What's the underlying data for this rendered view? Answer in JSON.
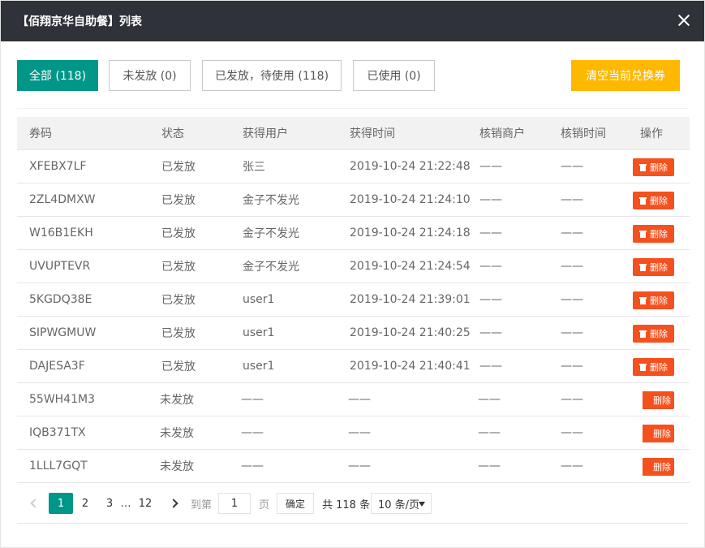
{
  "dialog": {
    "title": "【佰翔京华自助餐】列表"
  },
  "tabs": [
    {
      "label": "全部 (118)",
      "active": true
    },
    {
      "label": "未发放 (0)",
      "active": false
    },
    {
      "label": "已发放，待使用 (118)",
      "active": false
    },
    {
      "label": "已使用 (0)",
      "active": false
    }
  ],
  "clear_button": "清空当前兑换券",
  "table": {
    "headers": {
      "code": "券码",
      "status": "状态",
      "user": "获得用户",
      "time": "获得时间",
      "shop": "核销商户",
      "used_time": "核销时间",
      "op": "操作"
    },
    "delete_label": "删除",
    "rows": [
      {
        "code": "XFEBX7LF",
        "status": "已发放",
        "user": "张三",
        "time": "2019-10-24 21:22:48",
        "shop": "——",
        "used_time": "——"
      },
      {
        "code": "2ZL4DMXW",
        "status": "已发放",
        "user": "金子不发光",
        "time": "2019-10-24 21:24:10",
        "shop": "——",
        "used_time": "——"
      },
      {
        "code": "W16B1EKH",
        "status": "已发放",
        "user": "金子不发光",
        "time": "2019-10-24 21:24:18",
        "shop": "——",
        "used_time": "——"
      },
      {
        "code": "UVUPTEVR",
        "status": "已发放",
        "user": "金子不发光",
        "time": "2019-10-24 21:24:54",
        "shop": "——",
        "used_time": "——"
      },
      {
        "code": "5KGDQ38E",
        "status": "已发放",
        "user": "user1",
        "time": "2019-10-24 21:39:01",
        "shop": "——",
        "used_time": "——"
      },
      {
        "code": "SIPWGMUW",
        "status": "已发放",
        "user": "user1",
        "time": "2019-10-24 21:40:25",
        "shop": "——",
        "used_time": "——"
      },
      {
        "code": "DAJESA3F",
        "status": "已发放",
        "user": "user1",
        "time": "2019-10-24 21:40:41",
        "shop": "——",
        "used_time": "——"
      },
      {
        "code": "55WH41M3",
        "status": "未发放",
        "user": "——",
        "time": "——",
        "shop": "——",
        "used_time": "——"
      },
      {
        "code": "IQB371TX",
        "status": "未发放",
        "user": "——",
        "time": "——",
        "shop": "——",
        "used_time": "——"
      },
      {
        "code": "1LLL7GQT",
        "status": "未发放",
        "user": "——",
        "time": "——",
        "shop": "——",
        "used_time": "——"
      }
    ]
  },
  "pagination": {
    "pages": [
      "1",
      "2",
      "3",
      "…",
      "12"
    ],
    "current": "1",
    "goto_label": "到第",
    "goto_value": "1",
    "page_label": "页",
    "confirm_label": "确定",
    "total_label": "共 118 条",
    "page_size": "10 条/页"
  },
  "colors": {
    "primary": "#009688",
    "warning": "#ffb800",
    "danger": "#f4511e",
    "titlebar": "#2f3239"
  }
}
